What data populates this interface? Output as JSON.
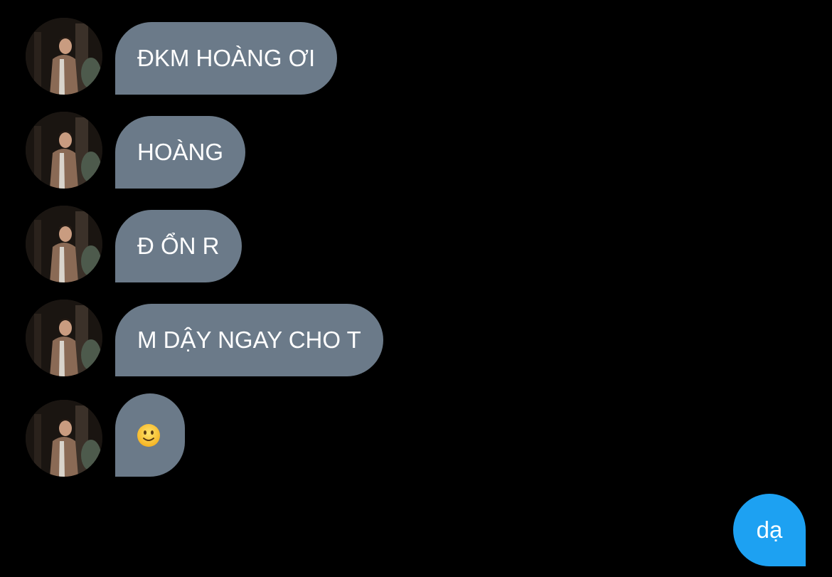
{
  "conversation": {
    "incoming": [
      {
        "text": "ĐKM HOÀNG ƠI"
      },
      {
        "text": "HOÀNG"
      },
      {
        "text": "Đ ỔN R"
      },
      {
        "text": "M DẬY NGAY CHO T"
      },
      {
        "text": "",
        "emoji": "slightly-smiling-face-icon"
      }
    ],
    "outgoing": [
      {
        "text": "dạ"
      }
    ]
  },
  "colors": {
    "background": "#000000",
    "incoming_bubble": "#6b7a89",
    "outgoing_bubble": "#1da1f2",
    "text": "#ffffff"
  }
}
